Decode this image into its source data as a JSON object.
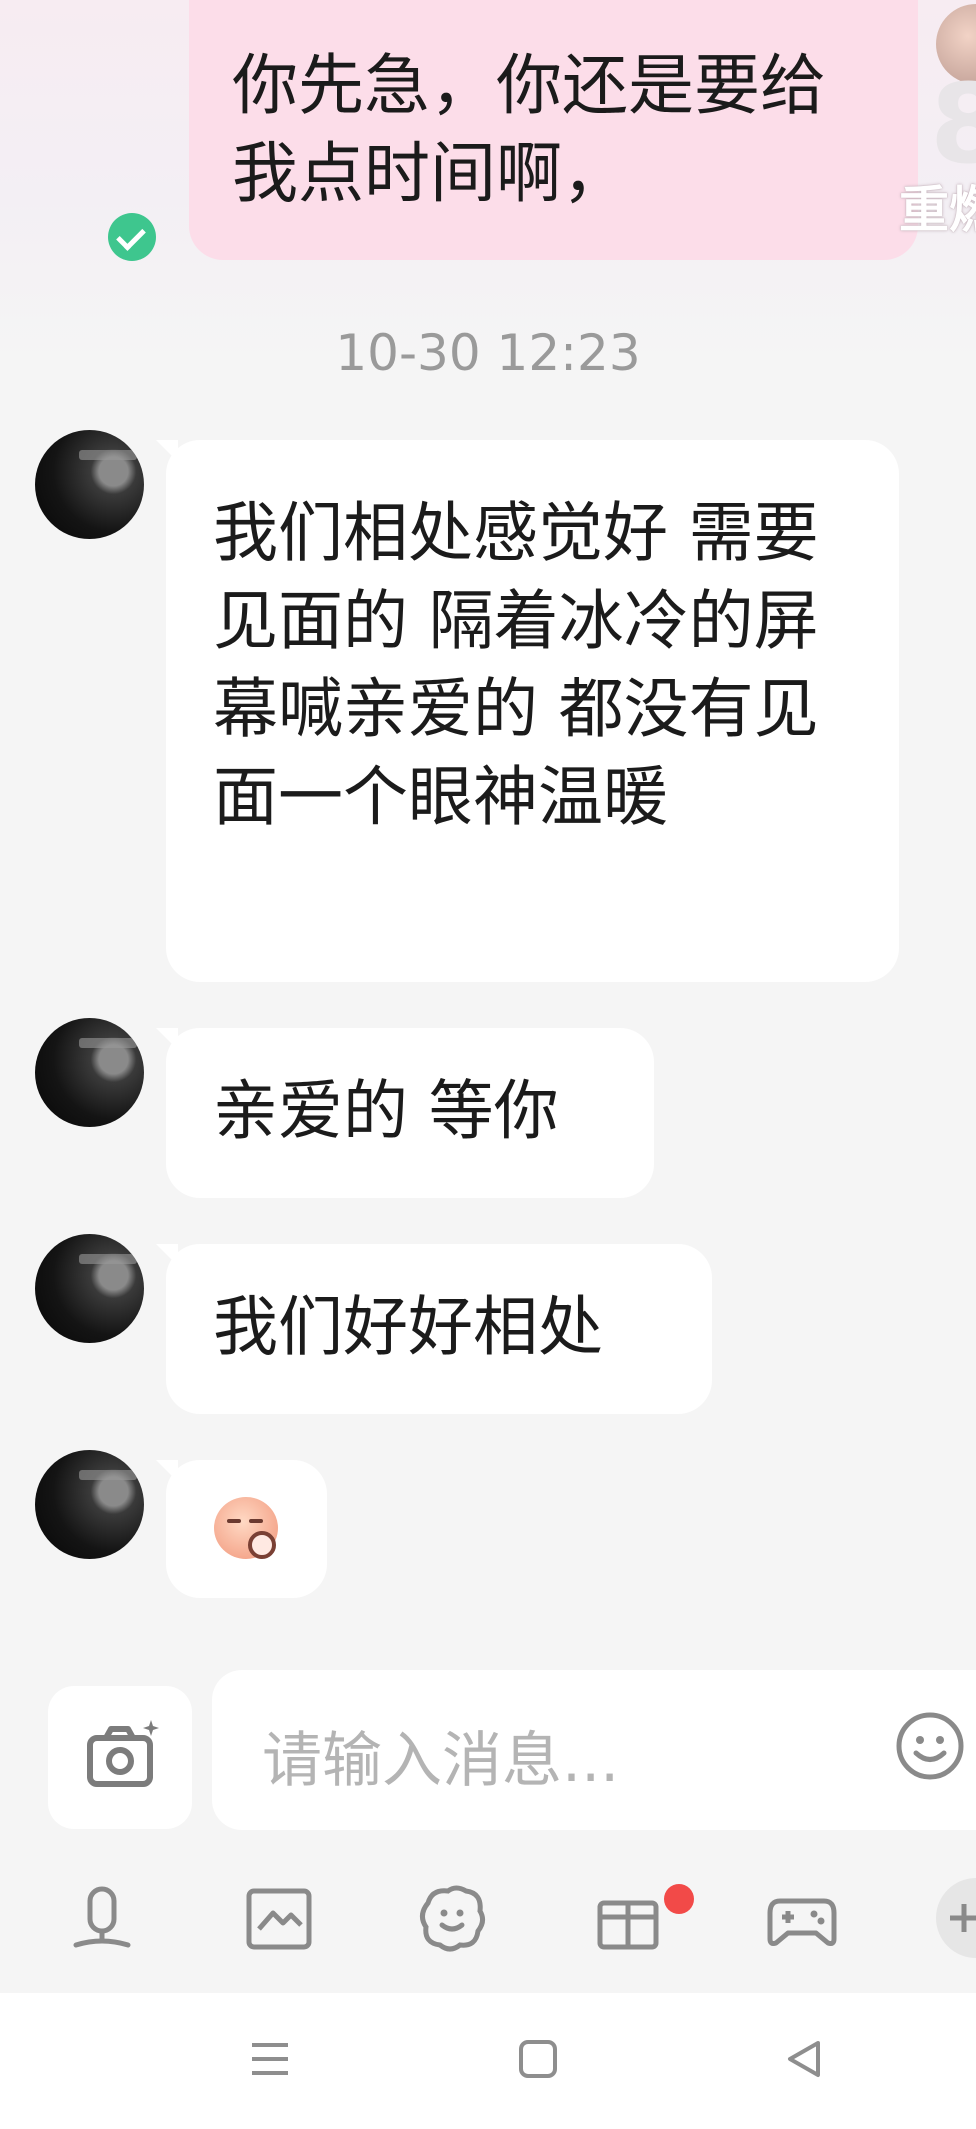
{
  "messages": {
    "sent_1": "你先急，你还是要给我点时间啊，",
    "timestamp": "10-30 12:23",
    "recv_1": "我们相处感觉好 需要见面的 隔着冰冷的屏幕喊亲爱的 都没有见面一个眼神温暖",
    "recv_2": "亲爱的 等你",
    "recv_3": "我们好好相处",
    "recv_4_sticker": "blushing-face-sticker"
  },
  "edge": {
    "partial_label": "重燃"
  },
  "composer": {
    "placeholder": "请输入消息..."
  },
  "toolbar": {
    "icons": [
      "microphone-icon",
      "image-icon",
      "sticker-icon",
      "gift-icon",
      "game-controller-icon",
      "plus-icon"
    ],
    "gift_badge_color": "#f24a48"
  },
  "navbar": {
    "icons": [
      "menu-icon",
      "home-icon",
      "back-icon"
    ]
  },
  "colors": {
    "sent_bubble": "#fcdde9",
    "received_bubble": "#ffffff",
    "read_check": "#3ec68e"
  }
}
